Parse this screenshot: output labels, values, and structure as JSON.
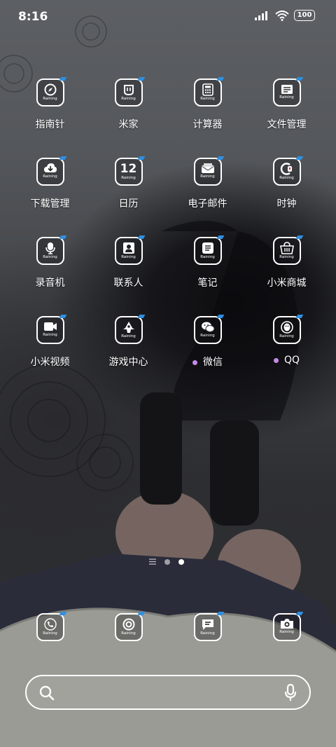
{
  "status_bar": {
    "time": "8:16",
    "battery": "100"
  },
  "badge_text": "Raining",
  "apps": [
    {
      "label": "指南针",
      "icon": "compass-icon",
      "name": "compass"
    },
    {
      "label": "米家",
      "icon": "mijia-icon",
      "name": "mijia"
    },
    {
      "label": "计算器",
      "icon": "calculator-icon",
      "name": "calculator"
    },
    {
      "label": "文件管理",
      "icon": "file-manager-icon",
      "name": "file-manager"
    },
    {
      "label": "下载管理",
      "icon": "download-icon",
      "name": "downloads"
    },
    {
      "label": "日历",
      "icon": "calendar-icon",
      "name": "calendar",
      "glyph": "12"
    },
    {
      "label": "电子邮件",
      "icon": "email-icon",
      "name": "email"
    },
    {
      "label": "时钟",
      "icon": "clock-icon",
      "name": "clock"
    },
    {
      "label": "录音机",
      "icon": "recorder-icon",
      "name": "recorder"
    },
    {
      "label": "联系人",
      "icon": "contacts-icon",
      "name": "contacts"
    },
    {
      "label": "笔记",
      "icon": "notes-icon",
      "name": "notes"
    },
    {
      "label": "小米商城",
      "icon": "mi-store-icon",
      "name": "mi-store"
    },
    {
      "label": "小米视频",
      "icon": "mi-video-icon",
      "name": "mi-video"
    },
    {
      "label": "游戏中心",
      "icon": "game-center-icon",
      "name": "game-center"
    },
    {
      "label": "微信",
      "icon": "wechat-icon",
      "name": "wechat",
      "badge": true
    },
    {
      "label": "QQ",
      "icon": "qq-icon",
      "name": "qq",
      "badge": true
    }
  ],
  "dock": [
    {
      "icon": "phone-icon",
      "name": "phone"
    },
    {
      "icon": "browser-icon",
      "name": "browser"
    },
    {
      "icon": "messages-icon",
      "name": "messages"
    },
    {
      "icon": "camera-icon",
      "name": "camera"
    }
  ],
  "pager": {
    "pages": 2,
    "current": 1
  },
  "search": {
    "search_icon": "search-icon",
    "mic_icon": "microphone-icon"
  },
  "colors": {
    "badge_dot": "#c78be8",
    "icon_corner": "#2f8fe0"
  }
}
